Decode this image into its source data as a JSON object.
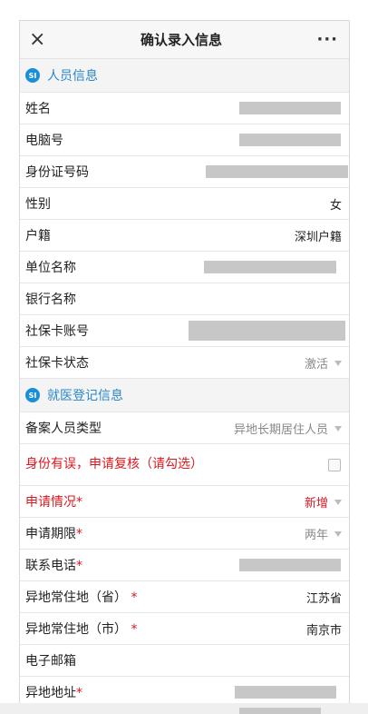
{
  "header": {
    "title": "确认录入信息",
    "close_icon": "×",
    "more_icon": "···"
  },
  "sections": {
    "personal": {
      "badge": "SI",
      "label": "人员信息"
    },
    "medical": {
      "badge": "SI",
      "label": "就医登记信息"
    }
  },
  "personal_fields": {
    "name": {
      "label": "姓名"
    },
    "computer_no": {
      "label": "电脑号"
    },
    "id_no": {
      "label": "身份证号码"
    },
    "gender": {
      "label": "性别",
      "value": "女"
    },
    "household": {
      "label": "户籍",
      "value": "深圳户籍"
    },
    "employer": {
      "label": "单位名称"
    },
    "bank": {
      "label": "银行名称"
    },
    "card_no": {
      "label": "社保卡账号"
    },
    "card_status": {
      "label": "社保卡状态",
      "value": "激活"
    }
  },
  "medical_fields": {
    "filing_type": {
      "label": "备案人员类型",
      "value": "异地长期居住人员"
    },
    "recheck": {
      "label": "身份有误，申请复核（请勾选）"
    },
    "application": {
      "label": "申请情况",
      "value": "新增"
    },
    "period": {
      "label": "申请期限",
      "value": "两年"
    },
    "phone": {
      "label": "联系电话"
    },
    "province": {
      "label": "异地常住地（省）",
      "value": "江苏省"
    },
    "city": {
      "label": "异地常住地（市）",
      "value": "南京市"
    },
    "email": {
      "label": "电子邮箱"
    },
    "address": {
      "label": "异地地址"
    }
  },
  "required_mark": "*",
  "colors": {
    "accent": "#1a8fd6",
    "required": "#d71920",
    "mask": "#c7c7c7"
  }
}
